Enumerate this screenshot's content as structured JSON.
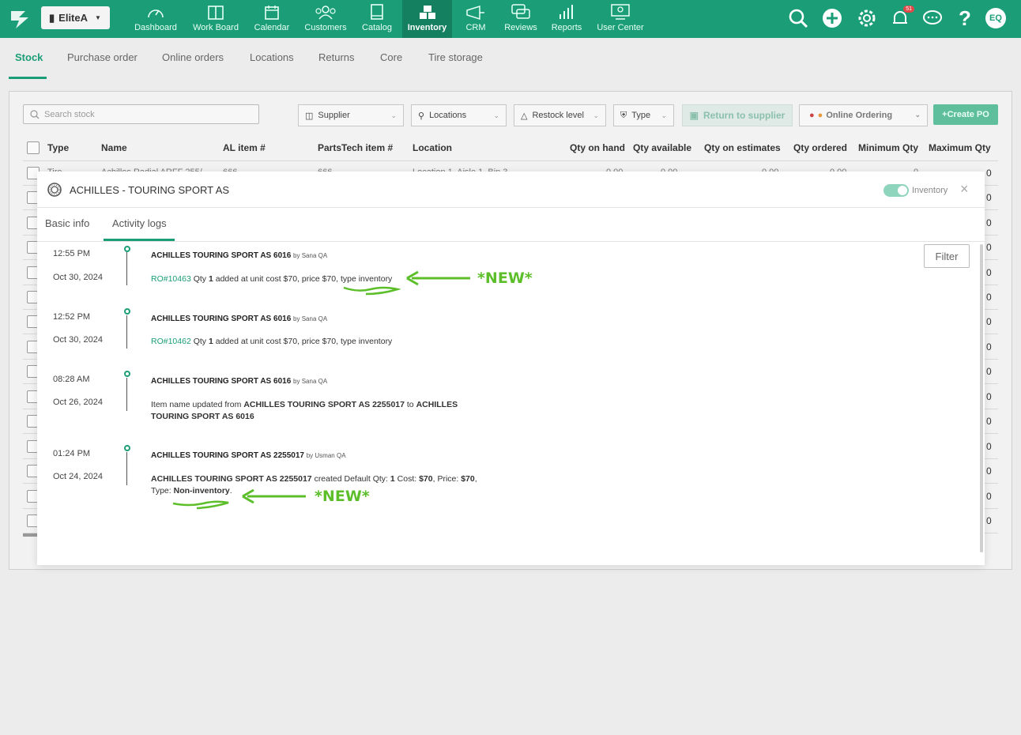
{
  "topbar": {
    "shop_name": "EliteA",
    "nav": [
      {
        "label": "Dashboard",
        "icon": "dashboard-icon"
      },
      {
        "label": "Work Board",
        "icon": "work-board-icon"
      },
      {
        "label": "Calendar",
        "icon": "calendar-icon"
      },
      {
        "label": "Customers",
        "icon": "customers-icon"
      },
      {
        "label": "Catalog",
        "icon": "catalog-icon"
      },
      {
        "label": "Inventory",
        "icon": "inventory-icon",
        "active": true
      },
      {
        "label": "CRM",
        "icon": "crm-icon"
      },
      {
        "label": "Reviews",
        "icon": "reviews-icon"
      },
      {
        "label": "Reports",
        "icon": "reports-icon"
      },
      {
        "label": "User Center",
        "icon": "user-center-icon"
      }
    ],
    "notification_count": "51",
    "avatar_initials": "EQ"
  },
  "subtabs": [
    "Stock",
    "Purchase order",
    "Online orders",
    "Locations",
    "Returns",
    "Core",
    "Tire storage"
  ],
  "toolbar": {
    "search_placeholder": "Search stock",
    "supplier": "Supplier",
    "locations": "Locations",
    "restock": "Restock level",
    "type": "Type",
    "return_to_supplier": "Return to supplier",
    "online_ordering": "Online Ordering",
    "create_po": "Create PO"
  },
  "table": {
    "columns": [
      "Type",
      "Name",
      "AL item #",
      "PartsTech item #",
      "Location",
      "Qty on hand",
      "Qty available",
      "Qty on estimates",
      "Qty ordered",
      "Minimum Qty",
      "Maximum Qty"
    ],
    "first_row": {
      "type": "Tire",
      "name": "Achilles Radial ARFF 255/",
      "al": "666",
      "pt": "666",
      "location": "Location 1, Aisle 1, Bin 3",
      "on_hand": "0.00",
      "available": "0.00",
      "estimates": "0.00",
      "ordered": "0.00",
      "min": "0"
    },
    "max_qty_values": [
      "0",
      "0",
      "0",
      "0",
      "0",
      "0",
      "0",
      "0",
      "0",
      "0",
      "0",
      "0",
      "0",
      "0",
      "0"
    ]
  },
  "colors": {
    "brand": "#1b9e77",
    "annotation": "#5cbf2a"
  },
  "modal": {
    "title": "ACHILLES - TOURING SPORT AS",
    "toggle_label": "Inventory",
    "close": "×",
    "tabs": [
      "Basic info",
      "Activity logs"
    ],
    "filter_label": "Filter",
    "logs": [
      {
        "time": "12:55 PM",
        "date": "Oct 30, 2024",
        "item": "ACHILLES TOURING SPORT AS 6016",
        "by": "by Sana QA",
        "ro": "RO#10463",
        "qty_prefix": "Qty",
        "qty": "1",
        "body": "added at unit cost $70, price $70, type inventory"
      },
      {
        "time": "12:52 PM",
        "date": "Oct 30, 2024",
        "item": "ACHILLES TOURING SPORT AS 6016",
        "by": "by Sana QA",
        "ro": "RO#10462",
        "qty_prefix": "Qty",
        "qty": "1",
        "body": "added at unit cost $70, price $70, type inventory"
      },
      {
        "time": "08:28 AM",
        "date": "Oct 26, 2024",
        "item": "ACHILLES TOURING SPORT AS 6016",
        "by": "by Sana QA",
        "body_prefix": "Item name updated from",
        "old_name": "ACHILLES TOURING SPORT AS 2255017",
        "connector": "to",
        "new_name": "ACHILLES TOURING SPORT AS 6016"
      },
      {
        "time": "01:24 PM",
        "date": "Oct 24, 2024",
        "item": "ACHILLES TOURING SPORT AS 2255017",
        "by": "by Usman QA",
        "created_name": "ACHILLES TOURING SPORT AS 2255017",
        "created_text": "created Default Qty:",
        "qty": "1",
        "cost_label": "Cost:",
        "cost": "$70",
        "price_label": "Price:",
        "price": "$70",
        "type_label": "Type:",
        "type_value": "Non-inventory"
      }
    ],
    "annotations": [
      "*NEW*",
      "*NEW*"
    ]
  }
}
